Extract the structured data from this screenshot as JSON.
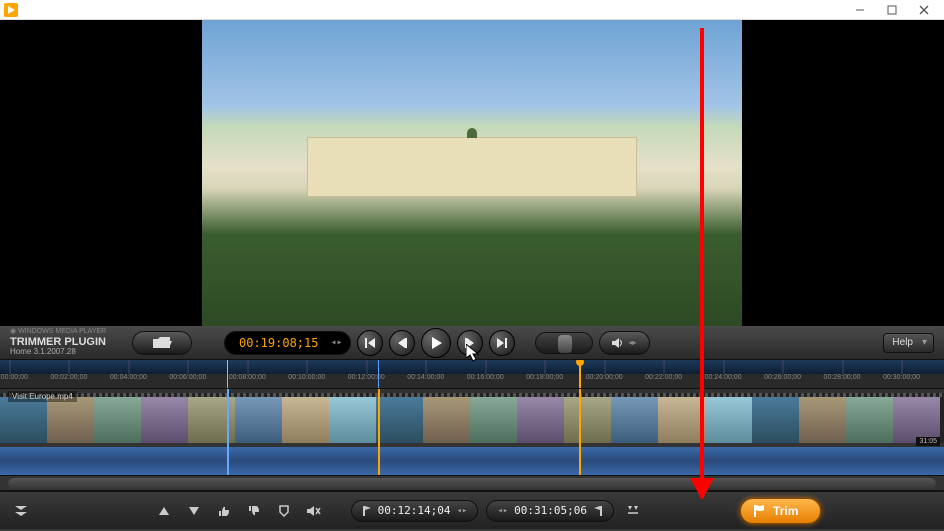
{
  "product": {
    "line1": "WINDOWS MEDIA PLAYER",
    "line2": "TRIMMER PLUGIN",
    "version": "Home 3.1.2007.28"
  },
  "playback": {
    "current_tc": "00:19:08;15"
  },
  "help": {
    "label": "Help"
  },
  "ruler_ticks": [
    {
      "label": "00:00:00;00",
      "pct": 1
    },
    {
      "label": "00:02:00;00",
      "pct": 7.3
    },
    {
      "label": "00:04:00;00",
      "pct": 13.6
    },
    {
      "label": "00:06:00;00",
      "pct": 19.9
    },
    {
      "label": "00:08:00;00",
      "pct": 26.2
    },
    {
      "label": "00:10:00;00",
      "pct": 32.5
    },
    {
      "label": "00:12:00;00",
      "pct": 38.8
    },
    {
      "label": "00:14:00;00",
      "pct": 45.1
    },
    {
      "label": "00:16:00;00",
      "pct": 51.4
    },
    {
      "label": "00:18:00;00",
      "pct": 57.7
    },
    {
      "label": "00:20:00;00",
      "pct": 64.0
    },
    {
      "label": "00:22:00;00",
      "pct": 70.3
    },
    {
      "label": "00:24:00;00",
      "pct": 76.6
    },
    {
      "label": "00:26:00;00",
      "pct": 82.9
    },
    {
      "label": "00:28:00;00",
      "pct": 89.2
    },
    {
      "label": "00:30:00;00",
      "pct": 95.5
    }
  ],
  "timeline": {
    "clip_name": "Visit Europe.mp4",
    "total_duration": "31:05",
    "in_point_pct": 24,
    "playhead_pct": 40,
    "out_point_pct": 61.3
  },
  "bottom": {
    "in_tc": "00:12:14;04",
    "out_tc": "00:31:05;06",
    "trim_label": "Trim"
  }
}
